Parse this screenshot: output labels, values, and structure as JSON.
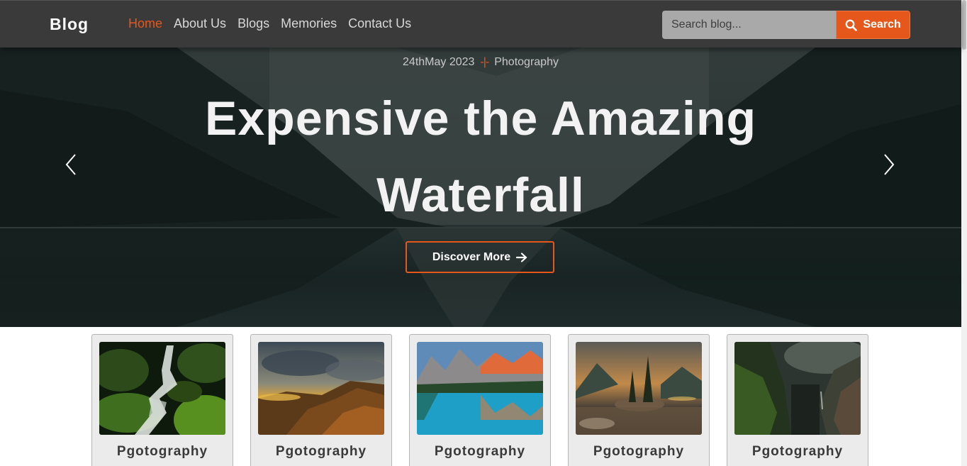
{
  "brand": "Blog",
  "nav": {
    "items": [
      {
        "label": "Home",
        "active": true
      },
      {
        "label": "About Us",
        "active": false
      },
      {
        "label": "Blogs",
        "active": false
      },
      {
        "label": "Memories",
        "active": false
      },
      {
        "label": "Contact Us",
        "active": false
      }
    ]
  },
  "search": {
    "placeholder": "Search blog...",
    "value": "",
    "button_label": "Search"
  },
  "hero": {
    "date": "24thMay 2023",
    "separator": "-|-",
    "category": "Photography",
    "title_line1": "Expensive the Amazing",
    "title_line2": "Waterfall",
    "button_label": "Discover More"
  },
  "cards": [
    {
      "caption": "Pgotography",
      "image": "waterfall"
    },
    {
      "caption": "Pgotography",
      "image": "hills-sunset"
    },
    {
      "caption": "Pgotography",
      "image": "mountain-lake"
    },
    {
      "caption": "Pgotography",
      "image": "island-trees"
    },
    {
      "caption": "Pgotography",
      "image": "canyon"
    }
  ],
  "colors": {
    "accent": "#e5571a",
    "navbar": "#3a3a3a",
    "card_bg": "#ebebeb"
  }
}
